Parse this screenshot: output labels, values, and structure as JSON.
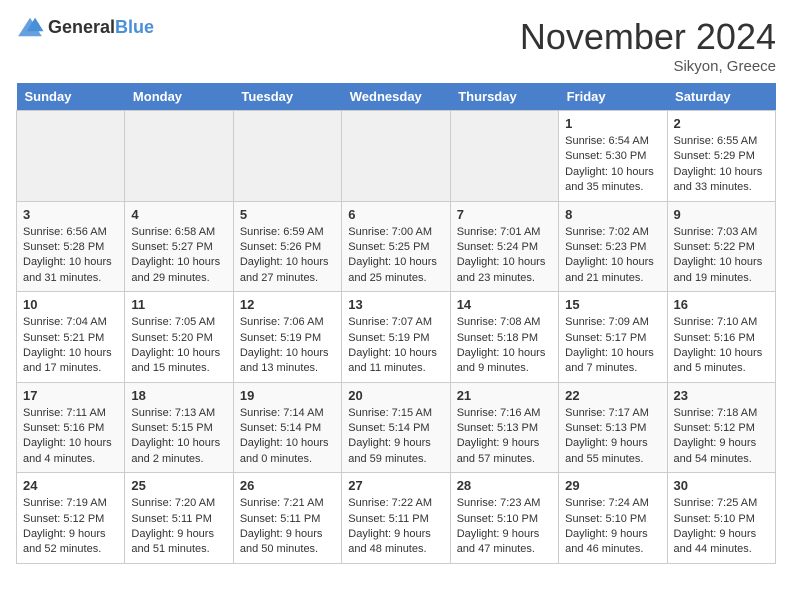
{
  "header": {
    "logo_general": "General",
    "logo_blue": "Blue",
    "month_title": "November 2024",
    "location": "Sikyon, Greece"
  },
  "days_of_week": [
    "Sunday",
    "Monday",
    "Tuesday",
    "Wednesday",
    "Thursday",
    "Friday",
    "Saturday"
  ],
  "weeks": [
    {
      "days": [
        {
          "empty": true
        },
        {
          "empty": true
        },
        {
          "empty": true
        },
        {
          "empty": true
        },
        {
          "empty": true
        },
        {
          "number": "1",
          "sunrise": "6:54 AM",
          "sunset": "5:30 PM",
          "daylight": "10 hours and 35 minutes."
        },
        {
          "number": "2",
          "sunrise": "6:55 AM",
          "sunset": "5:29 PM",
          "daylight": "10 hours and 33 minutes."
        }
      ]
    },
    {
      "days": [
        {
          "number": "3",
          "sunrise": "6:56 AM",
          "sunset": "5:28 PM",
          "daylight": "10 hours and 31 minutes."
        },
        {
          "number": "4",
          "sunrise": "6:58 AM",
          "sunset": "5:27 PM",
          "daylight": "10 hours and 29 minutes."
        },
        {
          "number": "5",
          "sunrise": "6:59 AM",
          "sunset": "5:26 PM",
          "daylight": "10 hours and 27 minutes."
        },
        {
          "number": "6",
          "sunrise": "7:00 AM",
          "sunset": "5:25 PM",
          "daylight": "10 hours and 25 minutes."
        },
        {
          "number": "7",
          "sunrise": "7:01 AM",
          "sunset": "5:24 PM",
          "daylight": "10 hours and 23 minutes."
        },
        {
          "number": "8",
          "sunrise": "7:02 AM",
          "sunset": "5:23 PM",
          "daylight": "10 hours and 21 minutes."
        },
        {
          "number": "9",
          "sunrise": "7:03 AM",
          "sunset": "5:22 PM",
          "daylight": "10 hours and 19 minutes."
        }
      ]
    },
    {
      "days": [
        {
          "number": "10",
          "sunrise": "7:04 AM",
          "sunset": "5:21 PM",
          "daylight": "10 hours and 17 minutes."
        },
        {
          "number": "11",
          "sunrise": "7:05 AM",
          "sunset": "5:20 PM",
          "daylight": "10 hours and 15 minutes."
        },
        {
          "number": "12",
          "sunrise": "7:06 AM",
          "sunset": "5:19 PM",
          "daylight": "10 hours and 13 minutes."
        },
        {
          "number": "13",
          "sunrise": "7:07 AM",
          "sunset": "5:19 PM",
          "daylight": "10 hours and 11 minutes."
        },
        {
          "number": "14",
          "sunrise": "7:08 AM",
          "sunset": "5:18 PM",
          "daylight": "10 hours and 9 minutes."
        },
        {
          "number": "15",
          "sunrise": "7:09 AM",
          "sunset": "5:17 PM",
          "daylight": "10 hours and 7 minutes."
        },
        {
          "number": "16",
          "sunrise": "7:10 AM",
          "sunset": "5:16 PM",
          "daylight": "10 hours and 5 minutes."
        }
      ]
    },
    {
      "days": [
        {
          "number": "17",
          "sunrise": "7:11 AM",
          "sunset": "5:16 PM",
          "daylight": "10 hours and 4 minutes."
        },
        {
          "number": "18",
          "sunrise": "7:13 AM",
          "sunset": "5:15 PM",
          "daylight": "10 hours and 2 minutes."
        },
        {
          "number": "19",
          "sunrise": "7:14 AM",
          "sunset": "5:14 PM",
          "daylight": "10 hours and 0 minutes."
        },
        {
          "number": "20",
          "sunrise": "7:15 AM",
          "sunset": "5:14 PM",
          "daylight": "9 hours and 59 minutes."
        },
        {
          "number": "21",
          "sunrise": "7:16 AM",
          "sunset": "5:13 PM",
          "daylight": "9 hours and 57 minutes."
        },
        {
          "number": "22",
          "sunrise": "7:17 AM",
          "sunset": "5:13 PM",
          "daylight": "9 hours and 55 minutes."
        },
        {
          "number": "23",
          "sunrise": "7:18 AM",
          "sunset": "5:12 PM",
          "daylight": "9 hours and 54 minutes."
        }
      ]
    },
    {
      "days": [
        {
          "number": "24",
          "sunrise": "7:19 AM",
          "sunset": "5:12 PM",
          "daylight": "9 hours and 52 minutes."
        },
        {
          "number": "25",
          "sunrise": "7:20 AM",
          "sunset": "5:11 PM",
          "daylight": "9 hours and 51 minutes."
        },
        {
          "number": "26",
          "sunrise": "7:21 AM",
          "sunset": "5:11 PM",
          "daylight": "9 hours and 50 minutes."
        },
        {
          "number": "27",
          "sunrise": "7:22 AM",
          "sunset": "5:11 PM",
          "daylight": "9 hours and 48 minutes."
        },
        {
          "number": "28",
          "sunrise": "7:23 AM",
          "sunset": "5:10 PM",
          "daylight": "9 hours and 47 minutes."
        },
        {
          "number": "29",
          "sunrise": "7:24 AM",
          "sunset": "5:10 PM",
          "daylight": "9 hours and 46 minutes."
        },
        {
          "number": "30",
          "sunrise": "7:25 AM",
          "sunset": "5:10 PM",
          "daylight": "9 hours and 44 minutes."
        }
      ]
    }
  ]
}
